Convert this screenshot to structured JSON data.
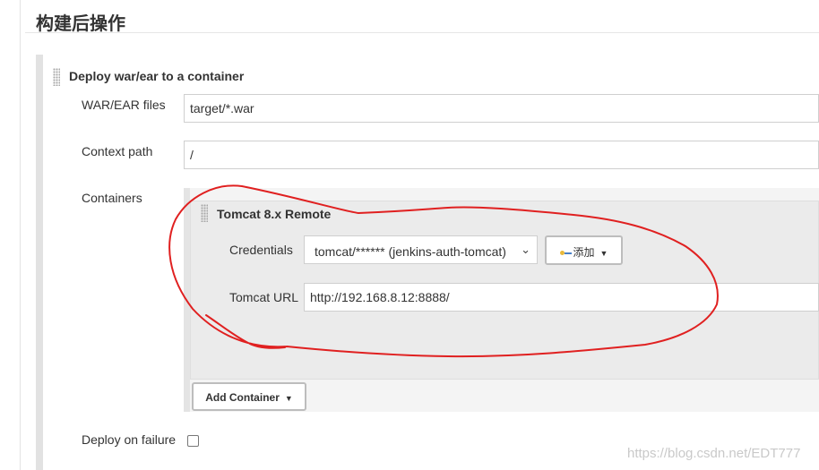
{
  "section": {
    "title": "构建后操作"
  },
  "step": {
    "title": "Deploy war/ear to a container",
    "war_files": {
      "label": "WAR/EAR files",
      "value": "target/*.war"
    },
    "context_path": {
      "label": "Context path",
      "value": "/"
    },
    "containers": {
      "label": "Containers",
      "item": {
        "title": "Tomcat 8.x Remote",
        "credentials": {
          "label": "Credentials",
          "selected": "tomcat/****** (jenkins-auth-tomcat)",
          "add_button": "添加"
        },
        "tomcat_url": {
          "label": "Tomcat URL",
          "value": "http://192.168.8.12:8888/"
        }
      },
      "add_button": "Add Container"
    },
    "deploy_on_failure": {
      "label": "Deploy on failure",
      "checked": false
    }
  },
  "watermark": "https://blog.csdn.net/EDT777",
  "annotation_color": "#e02020"
}
